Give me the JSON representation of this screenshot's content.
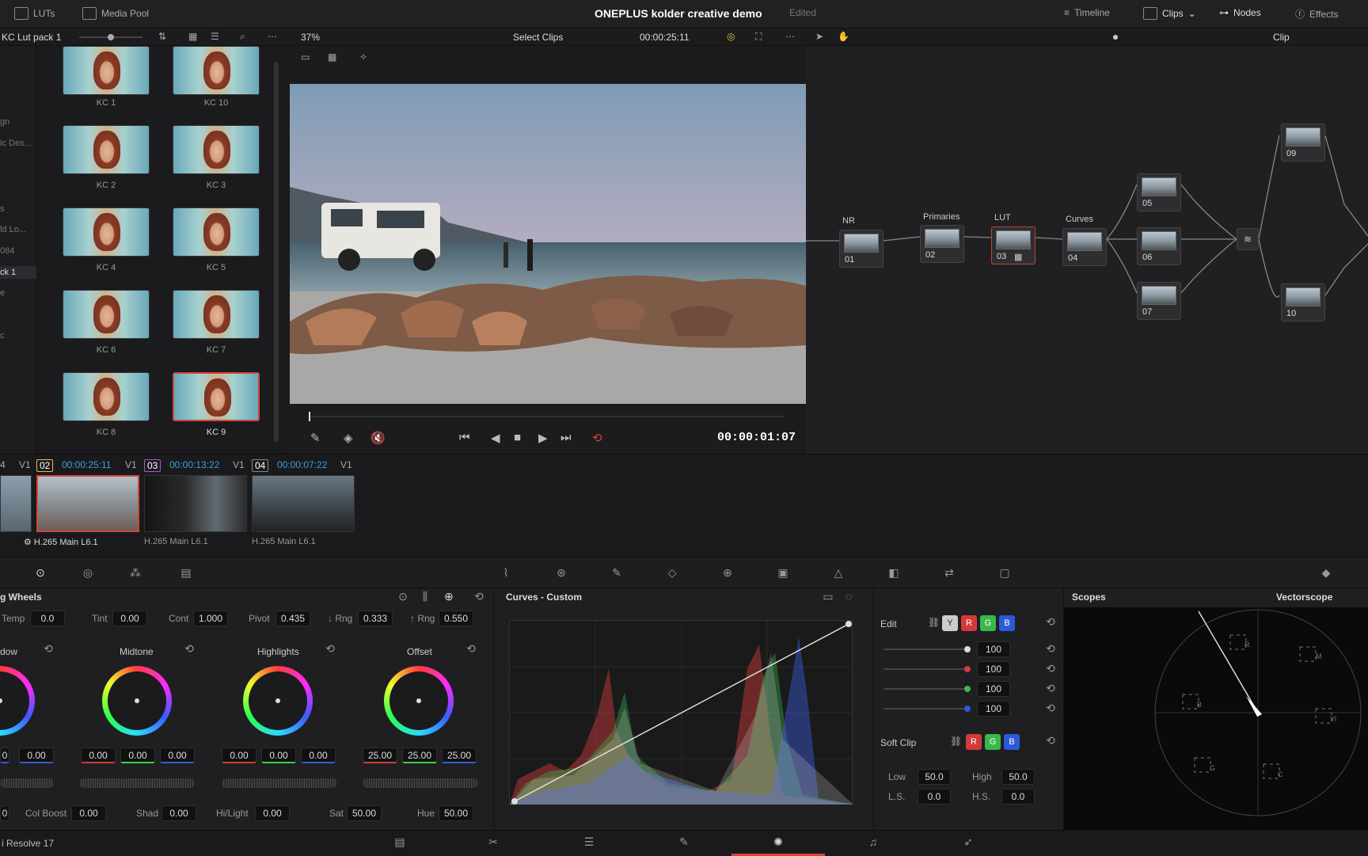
{
  "topbar": {
    "luts": "LUTs",
    "media_pool": "Media Pool",
    "project_title": "ONEPLUS kolder creative demo",
    "project_status": "Edited",
    "timeline": "Timeline",
    "clips": "Clips",
    "nodes": "Nodes",
    "effects": "Effects"
  },
  "subbar": {
    "lut_folder": "KC Lut pack 1",
    "zoom": "37%",
    "select_clips": "Select Clips",
    "source_tc": "00:00:25:11",
    "clip_mode": "Clip"
  },
  "lut_sidebar": [
    "gn",
    "ic Des...",
    "s",
    "ld Lo...",
    "084",
    "ck 1",
    "e",
    "c"
  ],
  "luts": [
    {
      "label": "KC 1"
    },
    {
      "label": "KC 10"
    },
    {
      "label": "KC 2"
    },
    {
      "label": "KC 3"
    },
    {
      "label": "KC 4"
    },
    {
      "label": "KC 5"
    },
    {
      "label": "KC 6"
    },
    {
      "label": "KC 7"
    },
    {
      "label": "KC 8"
    },
    {
      "label": "KC 9"
    }
  ],
  "viewer": {
    "timecode": "00:00:01:07"
  },
  "nodes": {
    "labels": {
      "nr": "NR",
      "primaries": "Primaries",
      "lut": "LUT",
      "curves": "Curves"
    },
    "items": [
      "01",
      "02",
      "03",
      "04",
      "05",
      "06",
      "07",
      "09",
      "10"
    ]
  },
  "clips": [
    {
      "num": "4",
      "tc": "",
      "track": "V1",
      "codec": ""
    },
    {
      "num": "02",
      "tc": "00:00:25:11",
      "track": "V1",
      "codec": "H.265 Main L6.1"
    },
    {
      "num": "03",
      "tc": "00:00:13:22",
      "track": "V1",
      "codec": "H.265 Main L6.1"
    },
    {
      "num": "04",
      "tc": "00:00:07:22",
      "track": "V1",
      "codec": "H.265 Main L6.1"
    }
  ],
  "wheels": {
    "title": "g Wheels",
    "params": {
      "temp_label": "Temp",
      "temp": "0.0",
      "tint_label": "Tint",
      "tint": "0.00",
      "cont_label": "Cont",
      "cont": "1.000",
      "pivot_label": "Pivot",
      "pivot": "0.435",
      "lrng_label": "↓ Rng",
      "lrng": "0.333",
      "hrng_label": "↑ Rng",
      "hrng": "0.550"
    },
    "names": {
      "shadow": "dow",
      "midtone": "Midtone",
      "highlights": "Highlights",
      "offset": "Offset"
    },
    "shadow_vals": [
      "0",
      "0.00"
    ],
    "midtone_vals": [
      "0.00",
      "0.00",
      "0.00"
    ],
    "highlight_vals": [
      "0.00",
      "0.00",
      "0.00"
    ],
    "offset_vals": [
      "25.00",
      "25.00",
      "25.00"
    ],
    "bottom": {
      "b0": "0",
      "colboost_label": "Col Boost",
      "colboost": "0.00",
      "shad_label": "Shad",
      "shad": "0.00",
      "hilight_label": "Hi/Light",
      "hilight": "0.00",
      "sat_label": "Sat",
      "sat": "50.00",
      "hue_label": "Hue",
      "hue": "50.00"
    }
  },
  "curves": {
    "title": "Curves - Custom"
  },
  "edit": {
    "title": "Edit",
    "y": "Y",
    "r": "R",
    "g": "G",
    "b": "B",
    "values": [
      "100",
      "100",
      "100",
      "100"
    ],
    "softclip": "Soft Clip",
    "low_label": "Low",
    "low": "50.0",
    "high_label": "High",
    "high": "50.0",
    "ls_label": "L.S.",
    "ls": "0.0",
    "hs_label": "H.S.",
    "hs": "0.0"
  },
  "scopes": {
    "title": "Scopes",
    "mode": "Vectorscope",
    "targets": [
      "R",
      "M",
      "B",
      "Yl",
      "G",
      "C"
    ]
  },
  "statusbar": {
    "app": "i Resolve 17"
  }
}
